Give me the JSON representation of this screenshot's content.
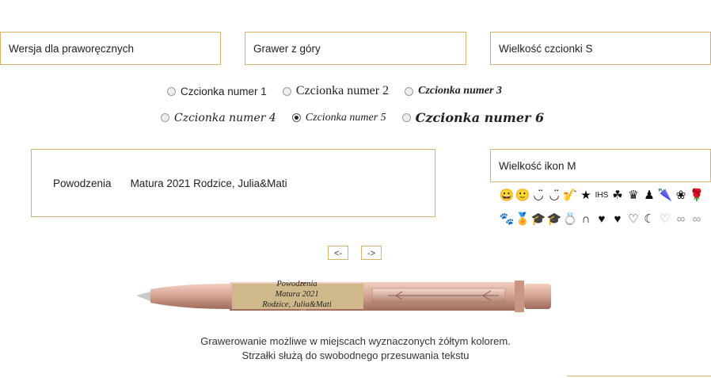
{
  "selects": {
    "hand": "Wersja dla praworęcznych",
    "position": "Grawer z góry",
    "font_size": "Wielkość czcionki S",
    "icon_size": "Wielkość ikon M"
  },
  "fonts": {
    "selected": "Czcionka numer 5",
    "options": [
      "Czcionka numer 1",
      "Czcionka numer 2",
      "Czcionka numer 3",
      "Czcionka numer 4",
      "Czcionka numer 5",
      "Czcionka numer 6"
    ]
  },
  "engraving": {
    "field1": "Powodzenia",
    "field2": "Matura 2021 Rodzice, Julia&Mati",
    "preview_lines": [
      "Powodzenia",
      "Matura 2021",
      "Rodzice, Julia&Mati"
    ]
  },
  "nav": {
    "left": "<-",
    "right": "->"
  },
  "icons": {
    "row1": [
      "😀",
      "🙂",
      "◡̈",
      "◡̈",
      "🎷",
      "★",
      "IHS",
      "☘",
      "♛",
      "♟",
      "🌂",
      "❀",
      "🌹"
    ],
    "row2": [
      "🐾",
      "🏅",
      "🎓",
      "🎓",
      "💍",
      "∩",
      "♥",
      "♥",
      "♡",
      "☾",
      "♡",
      "∞",
      "∞"
    ]
  },
  "caption": {
    "line1": "Grawerowanie możliwe w miejscach wyznaczonych żółtym kolorem.",
    "line2": "Strzałki służą do swobodnego przesuwania tekstu"
  },
  "colors": {
    "accent": "#d9b36a",
    "pen": "#d4a18e",
    "engrave_area": "#cfb98a"
  }
}
